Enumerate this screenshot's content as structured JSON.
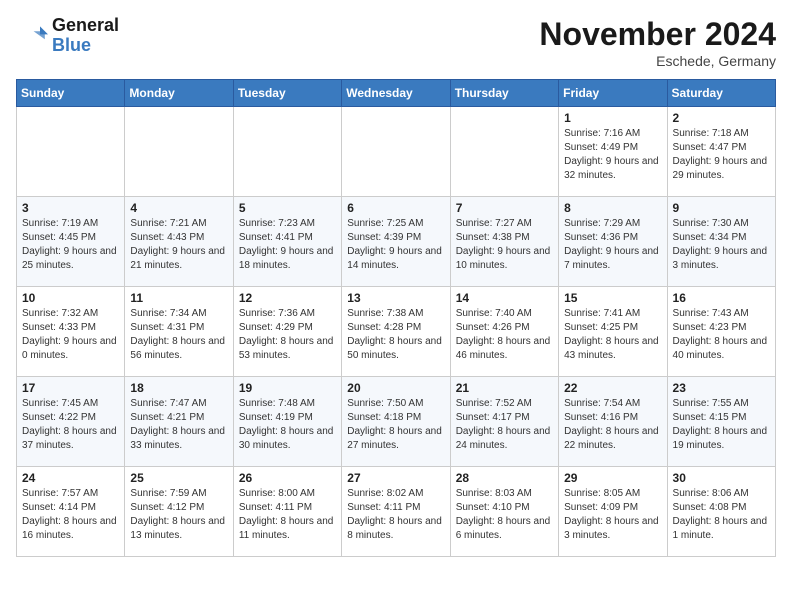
{
  "app": {
    "name_line1": "General",
    "name_line2": "Blue"
  },
  "header": {
    "month": "November 2024",
    "location": "Eschede, Germany"
  },
  "weekdays": [
    "Sunday",
    "Monday",
    "Tuesday",
    "Wednesday",
    "Thursday",
    "Friday",
    "Saturday"
  ],
  "weeks": [
    [
      {
        "day": "",
        "info": ""
      },
      {
        "day": "",
        "info": ""
      },
      {
        "day": "",
        "info": ""
      },
      {
        "day": "",
        "info": ""
      },
      {
        "day": "",
        "info": ""
      },
      {
        "day": "1",
        "info": "Sunrise: 7:16 AM\nSunset: 4:49 PM\nDaylight: 9 hours and 32 minutes."
      },
      {
        "day": "2",
        "info": "Sunrise: 7:18 AM\nSunset: 4:47 PM\nDaylight: 9 hours and 29 minutes."
      }
    ],
    [
      {
        "day": "3",
        "info": "Sunrise: 7:19 AM\nSunset: 4:45 PM\nDaylight: 9 hours and 25 minutes."
      },
      {
        "day": "4",
        "info": "Sunrise: 7:21 AM\nSunset: 4:43 PM\nDaylight: 9 hours and 21 minutes."
      },
      {
        "day": "5",
        "info": "Sunrise: 7:23 AM\nSunset: 4:41 PM\nDaylight: 9 hours and 18 minutes."
      },
      {
        "day": "6",
        "info": "Sunrise: 7:25 AM\nSunset: 4:39 PM\nDaylight: 9 hours and 14 minutes."
      },
      {
        "day": "7",
        "info": "Sunrise: 7:27 AM\nSunset: 4:38 PM\nDaylight: 9 hours and 10 minutes."
      },
      {
        "day": "8",
        "info": "Sunrise: 7:29 AM\nSunset: 4:36 PM\nDaylight: 9 hours and 7 minutes."
      },
      {
        "day": "9",
        "info": "Sunrise: 7:30 AM\nSunset: 4:34 PM\nDaylight: 9 hours and 3 minutes."
      }
    ],
    [
      {
        "day": "10",
        "info": "Sunrise: 7:32 AM\nSunset: 4:33 PM\nDaylight: 9 hours and 0 minutes."
      },
      {
        "day": "11",
        "info": "Sunrise: 7:34 AM\nSunset: 4:31 PM\nDaylight: 8 hours and 56 minutes."
      },
      {
        "day": "12",
        "info": "Sunrise: 7:36 AM\nSunset: 4:29 PM\nDaylight: 8 hours and 53 minutes."
      },
      {
        "day": "13",
        "info": "Sunrise: 7:38 AM\nSunset: 4:28 PM\nDaylight: 8 hours and 50 minutes."
      },
      {
        "day": "14",
        "info": "Sunrise: 7:40 AM\nSunset: 4:26 PM\nDaylight: 8 hours and 46 minutes."
      },
      {
        "day": "15",
        "info": "Sunrise: 7:41 AM\nSunset: 4:25 PM\nDaylight: 8 hours and 43 minutes."
      },
      {
        "day": "16",
        "info": "Sunrise: 7:43 AM\nSunset: 4:23 PM\nDaylight: 8 hours and 40 minutes."
      }
    ],
    [
      {
        "day": "17",
        "info": "Sunrise: 7:45 AM\nSunset: 4:22 PM\nDaylight: 8 hours and 37 minutes."
      },
      {
        "day": "18",
        "info": "Sunrise: 7:47 AM\nSunset: 4:21 PM\nDaylight: 8 hours and 33 minutes."
      },
      {
        "day": "19",
        "info": "Sunrise: 7:48 AM\nSunset: 4:19 PM\nDaylight: 8 hours and 30 minutes."
      },
      {
        "day": "20",
        "info": "Sunrise: 7:50 AM\nSunset: 4:18 PM\nDaylight: 8 hours and 27 minutes."
      },
      {
        "day": "21",
        "info": "Sunrise: 7:52 AM\nSunset: 4:17 PM\nDaylight: 8 hours and 24 minutes."
      },
      {
        "day": "22",
        "info": "Sunrise: 7:54 AM\nSunset: 4:16 PM\nDaylight: 8 hours and 22 minutes."
      },
      {
        "day": "23",
        "info": "Sunrise: 7:55 AM\nSunset: 4:15 PM\nDaylight: 8 hours and 19 minutes."
      }
    ],
    [
      {
        "day": "24",
        "info": "Sunrise: 7:57 AM\nSunset: 4:14 PM\nDaylight: 8 hours and 16 minutes."
      },
      {
        "day": "25",
        "info": "Sunrise: 7:59 AM\nSunset: 4:12 PM\nDaylight: 8 hours and 13 minutes."
      },
      {
        "day": "26",
        "info": "Sunrise: 8:00 AM\nSunset: 4:11 PM\nDaylight: 8 hours and 11 minutes."
      },
      {
        "day": "27",
        "info": "Sunrise: 8:02 AM\nSunset: 4:11 PM\nDaylight: 8 hours and 8 minutes."
      },
      {
        "day": "28",
        "info": "Sunrise: 8:03 AM\nSunset: 4:10 PM\nDaylight: 8 hours and 6 minutes."
      },
      {
        "day": "29",
        "info": "Sunrise: 8:05 AM\nSunset: 4:09 PM\nDaylight: 8 hours and 3 minutes."
      },
      {
        "day": "30",
        "info": "Sunrise: 8:06 AM\nSunset: 4:08 PM\nDaylight: 8 hours and 1 minute."
      }
    ]
  ]
}
